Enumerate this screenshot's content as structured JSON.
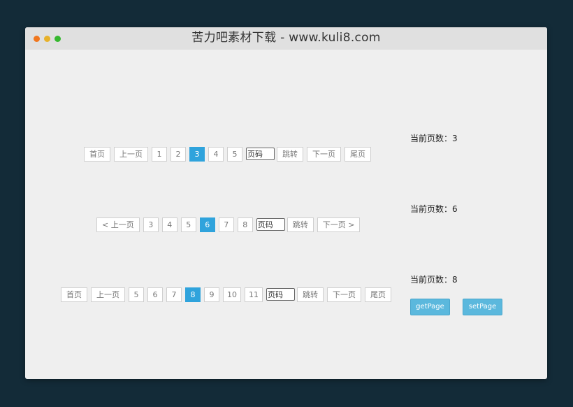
{
  "window": {
    "title": "苦力吧素材下载 - www.kuli8.com"
  },
  "pager1": {
    "first": "首页",
    "prev": "上一页",
    "pages": [
      "1",
      "2",
      "3",
      "4",
      "5"
    ],
    "active_page": "3",
    "input_placeholder": "页码",
    "jump": "跳转",
    "next": "下一页",
    "last": "尾页",
    "current_label": "当前页数：3"
  },
  "pager2": {
    "prev": "< 上一页",
    "pages": [
      "3",
      "4",
      "5",
      "6",
      "7",
      "8"
    ],
    "active_page": "6",
    "input_placeholder": "页码",
    "jump": "跳转",
    "next": "下一页 >",
    "current_label": "当前页数：6"
  },
  "pager3": {
    "first": "首页",
    "prev": "上一页",
    "pages": [
      "5",
      "6",
      "7",
      "8",
      "9",
      "10",
      "11"
    ],
    "active_page": "8",
    "input_placeholder": "页码",
    "jump": "跳转",
    "next": "下一页",
    "last": "尾页",
    "current_label": "当前页数：8",
    "get_button": "getPage",
    "set_button": "setPage"
  },
  "colors": {
    "active": "#2fa3dc",
    "action_button": "#5bb8dd",
    "background": "#132b38"
  }
}
